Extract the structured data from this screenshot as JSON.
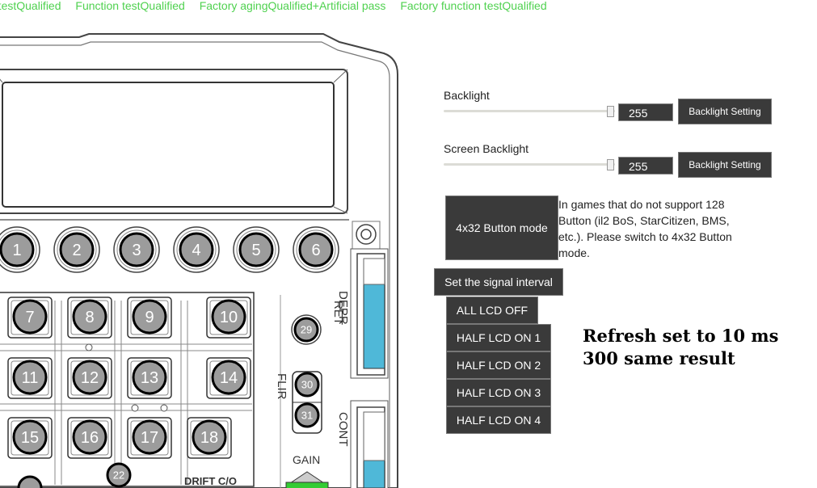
{
  "status_bar": [
    "d testQualified",
    "Function testQualified",
    "Factory agingQualified+Artificial pass",
    "Factory function testQualified"
  ],
  "backlight": {
    "label": "Backlight",
    "value": "255",
    "button": "Backlight Setting"
  },
  "screen_backlight": {
    "label": "Screen Backlight",
    "value": "255",
    "button": "Backlight Setting"
  },
  "mode_button": "4x32 Button mode",
  "mode_description": "In games that do not support 128 Button (il2 BoS, StarCitizen, BMS, etc.). Please switch to 4x32 Button mode.",
  "signal_interval_button": "Set the signal interval",
  "lcd_buttons": [
    "ALL LCD OFF",
    "HALF LCD ON 1",
    "HALF LCD ON 2",
    "HALF LCD ON 3",
    "HALF LCD ON 4"
  ],
  "annotation": [
    "Refresh set to 10 ms",
    "300 same result"
  ],
  "device": {
    "top_buttons": [
      "1",
      "2",
      "3",
      "4",
      "5",
      "6"
    ],
    "grid_buttons": [
      "7",
      "8",
      "9",
      "10",
      "11",
      "12",
      "13",
      "14",
      "15",
      "16",
      "17",
      "18"
    ],
    "side_buttons": [
      "29",
      "30",
      "31"
    ],
    "bottom_button": "22",
    "labels": {
      "ret": "RET",
      "depr": "DEPR",
      "flir": "FLIR",
      "cont": "CONT",
      "gain": "GAIN",
      "drift": "DRIFT C/O"
    }
  }
}
